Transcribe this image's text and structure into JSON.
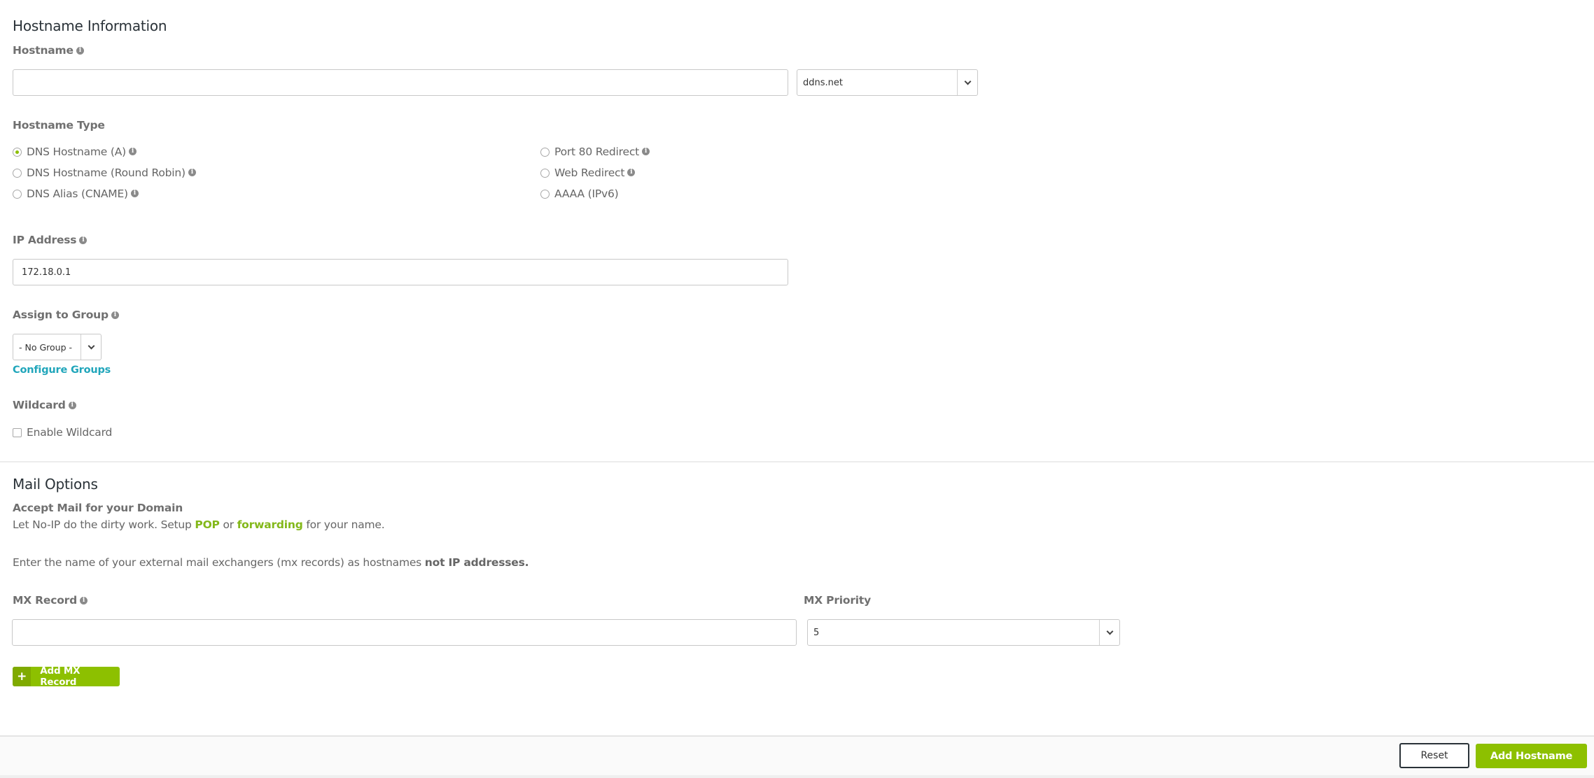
{
  "hostname_section": {
    "title": "Hostname Information",
    "hostname_label": "Hostname",
    "hostname_value": "",
    "domain_select": "ddns.net"
  },
  "hostname_type": {
    "label": "Hostname Type",
    "options": [
      {
        "label": "DNS Hostname (A)",
        "checked": true,
        "info": true
      },
      {
        "label": "DNS Hostname (Round Robin)",
        "checked": false,
        "info": true
      },
      {
        "label": "DNS Alias (CNAME)",
        "checked": false,
        "info": true
      },
      {
        "label": "Port 80 Redirect",
        "checked": false,
        "info": true
      },
      {
        "label": "Web Redirect",
        "checked": false,
        "info": true
      },
      {
        "label": "AAAA (IPv6)",
        "checked": false,
        "info": false
      }
    ]
  },
  "ip_address": {
    "label": "IP Address",
    "value": "172.18.0.1"
  },
  "group": {
    "label": "Assign to Group",
    "selected": "- No Group -",
    "configure_link": "Configure Groups"
  },
  "wildcard": {
    "label": "Wildcard",
    "checkbox_label": "Enable Wildcard",
    "checked": false
  },
  "mail": {
    "title": "Mail Options",
    "subtitle": "Accept Mail for your Domain",
    "desc_prefix": "Let No-IP do the dirty work. Setup ",
    "pop_link": "POP",
    "desc_or": " or ",
    "forwarding_link": "forwarding",
    "desc_suffix": " for your name.",
    "mx_instruction_prefix": "Enter the name of your external mail exchangers (mx records) as hostnames ",
    "mx_instruction_bold": "not IP addresses.",
    "mx_record_label": "MX Record",
    "mx_record_value": "",
    "mx_priority_label": "MX Priority",
    "mx_priority_value": "5",
    "add_mx_button": "Add MX Record",
    "add_mx_icon": "+"
  },
  "footer": {
    "reset_button": "Reset",
    "add_hostname_button": "Add Hostname"
  },
  "colors": {
    "accent_green": "#8dc000",
    "link_teal": "#21a6bb",
    "heading": "#2a3238"
  }
}
